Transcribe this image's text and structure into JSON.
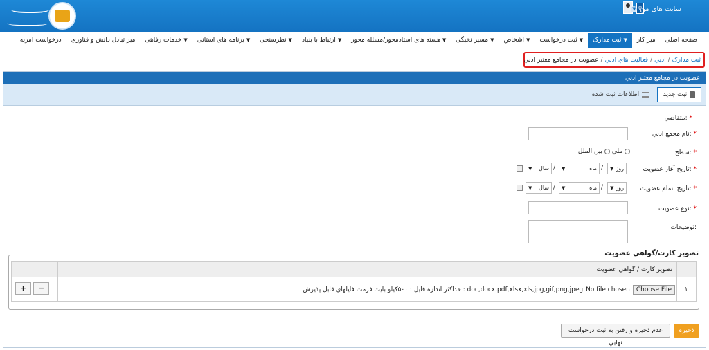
{
  "header": {
    "my_sites": "سایت های من",
    "notif_count": "0"
  },
  "nav": {
    "items": [
      "صفحه اصلی",
      "میز کار",
      "ثبت مدارک",
      "ثبت درخواست",
      "اشخاص",
      "مسیر نخبگی",
      "هسته های استادمحور/مسئله محور",
      "ارتباط با بنیاد",
      "نظرسنجی",
      "برنامه های استانی",
      "خدمات رفاهی",
      "میز تبادل دانش و فناوری",
      "درخواست امریه"
    ],
    "active": "ثبت مدارک"
  },
  "breadcrumb": [
    "ثبت مدارک",
    "ادبي",
    "فعاليت هاي ادبي",
    "عضويت در مجامع معتبر ادبي"
  ],
  "panel": {
    "title": "عضويت در مجامع معتبر ادبي"
  },
  "toolbar": {
    "new_label": "ثبت جدید",
    "saved_label": "اطلاعات ثبت شده"
  },
  "form": {
    "applicant_label": "متقاضي:",
    "assembly_label": "نام مجمع ادبي:",
    "level_label": "سطح:",
    "level_options": [
      "ملي",
      "بين الملل"
    ],
    "start_label": "تاريخ آغاز عضويت:",
    "end_label": "تاريخ اتمام عضويت:",
    "date_parts": {
      "day": "روز",
      "month": "ماه",
      "year": "سال"
    },
    "type_label": "نوع عضويت:",
    "desc_label": "توضيحات:"
  },
  "attachments": {
    "legend": "تصوير كارت/گواهي عضويت",
    "col_header": "تصوير كارت / گواهي عضويت",
    "row_num": "۱",
    "choose_file": "Choose File",
    "no_file": "No file chosen",
    "hint": "حداكثر اندازه فايل : ۵۰۰كيلو بايت فرمت فايلهاي قابل پذيرش : doc,docx,pdf,xlsx,xls,jpg,gif,png,jpeg",
    "plus": "+",
    "minus": "−"
  },
  "actions": {
    "save": "ذخيره",
    "no_save": "عدم ذخيره و رفتن به ثبت درخواست نهايي"
  }
}
